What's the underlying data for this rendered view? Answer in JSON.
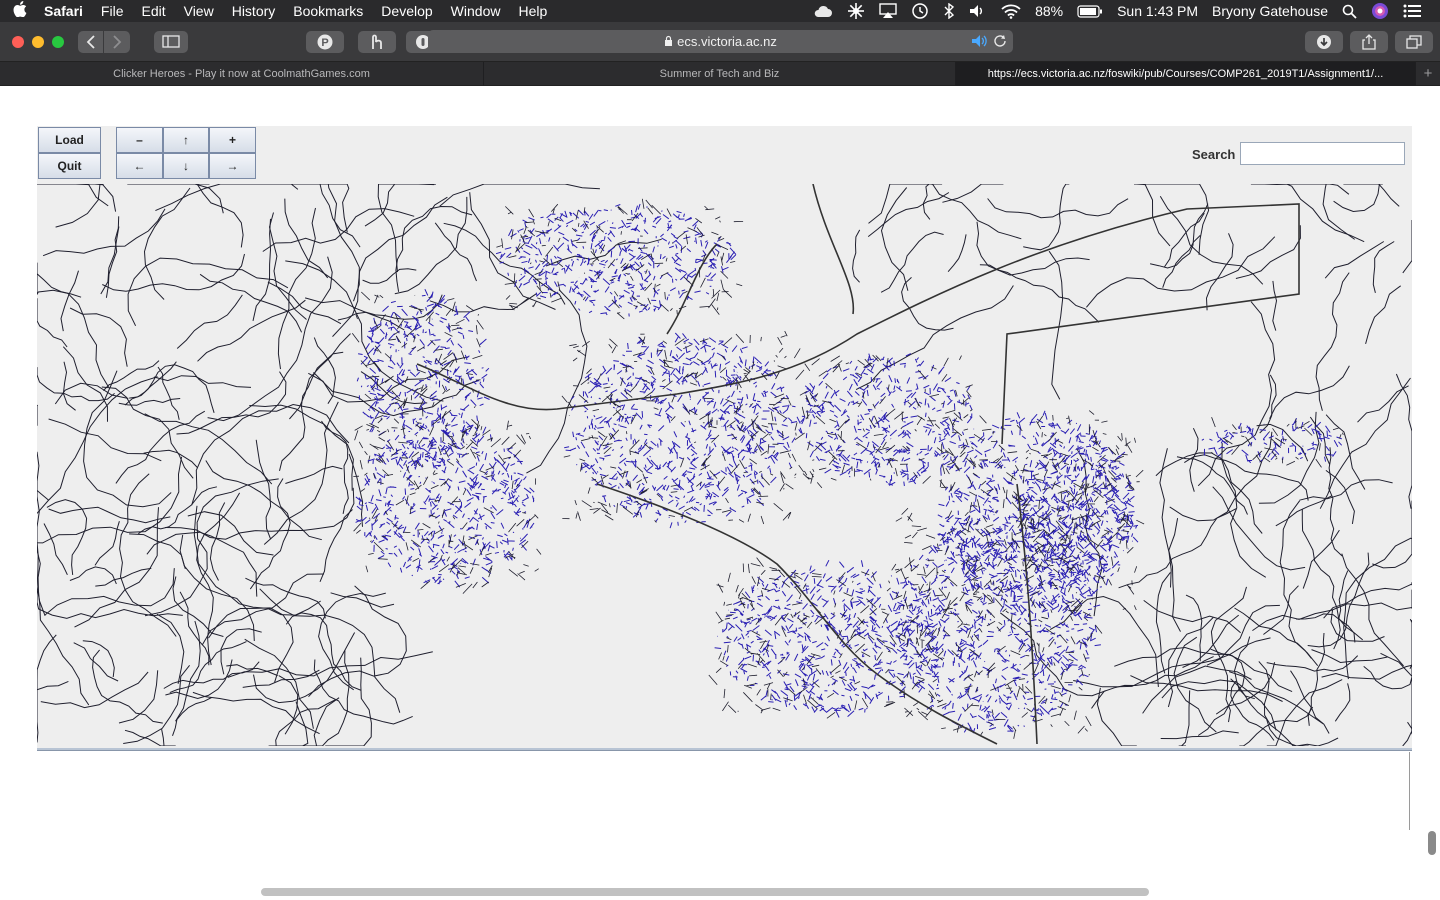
{
  "menubar": {
    "app_name": "Safari",
    "items": [
      "File",
      "Edit",
      "View",
      "History",
      "Bookmarks",
      "Develop",
      "Window",
      "Help"
    ],
    "battery": "88%",
    "clock": "Sun 1:43 PM",
    "user": "Bryony Gatehouse"
  },
  "toolbar": {
    "url": "ecs.victoria.ac.nz"
  },
  "tabs": [
    {
      "title": "Clicker Heroes - Play it now at CoolmathGames.com",
      "active": false
    },
    {
      "title": "Summer of Tech and Biz",
      "active": false
    },
    {
      "title": "https://ecs.victoria.ac.nz/foswiki/pub/Courses/COMP261_2019T1/Assignment1/...",
      "active": true
    }
  ],
  "applet": {
    "load_label": "Load",
    "quit_label": "Quit",
    "zoom_out_label": "–",
    "up_label": "↑",
    "zoom_in_label": "+",
    "left_label": "←",
    "down_label": "↓",
    "right_label": "→",
    "search_label": "Search",
    "search_value": ""
  },
  "map": {
    "road_color": "#1f1f2e",
    "node_color": "#2a1fb3"
  }
}
